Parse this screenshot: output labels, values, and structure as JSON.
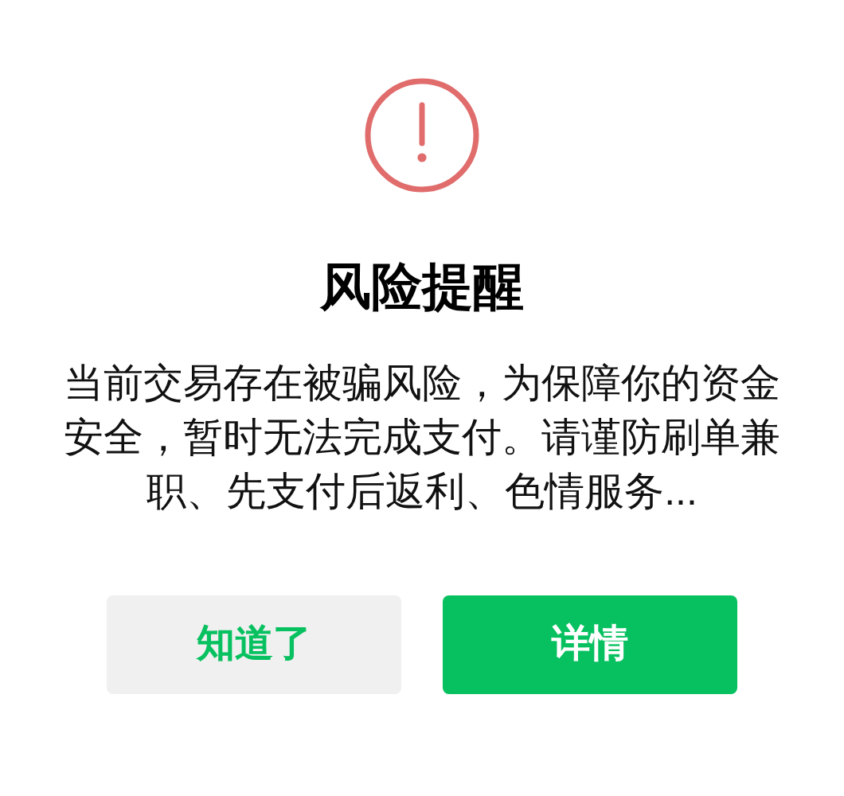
{
  "dialog": {
    "title": "风险提醒",
    "message": "当前交易存在被骗风险，为保障你的资金安全，暂时无法完成支付。请谨防刷单兼职、先支付后返利、色情服务...",
    "buttons": [
      {
        "label": "知道了",
        "kind": "secondary"
      },
      {
        "label": "详情",
        "kind": "primary"
      }
    ]
  }
}
